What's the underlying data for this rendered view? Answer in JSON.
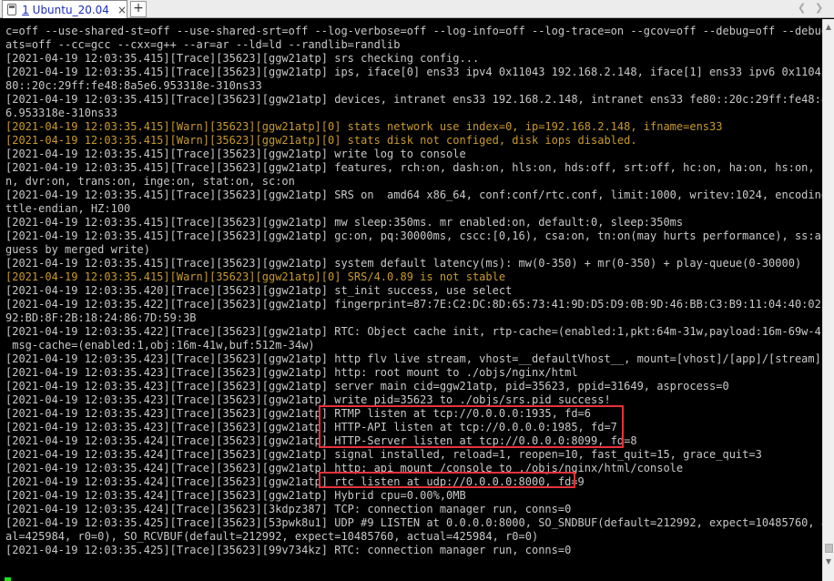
{
  "tabs": [
    {
      "number": "1",
      "label": "Ubuntu_20.04",
      "close": "×"
    }
  ],
  "tabbar": {
    "add": "+",
    "prev": "❮",
    "next": "❯"
  },
  "terminal": {
    "lines": [
      {
        "text": "c=off --use-shared-st=off --use-shared-srt=off --log-verbose=off --log-info=off --log-trace=on --gcov=off --debug=off --debug-st",
        "level": "trace"
      },
      {
        "text": "ats=off --cc=gcc --cxx=g++ --ar=ar --ld=ld --randlib=randlib",
        "level": "trace"
      },
      {
        "text": "[2021-04-19 12:03:35.415][Trace][35623][ggw21atp] srs checking config...",
        "level": "trace"
      },
      {
        "text": "[2021-04-19 12:03:35.415][Trace][35623][ggw21atp] ips, iface[0] ens33 ipv4 0x11043 192.168.2.148, iface[1] ens33 ipv6 0x11043 fe",
        "level": "trace"
      },
      {
        "text": "80::20c:29ff:fe48:8a5e6.953318e-310ns33",
        "level": "trace"
      },
      {
        "text": "[2021-04-19 12:03:35.415][Trace][35623][ggw21atp] devices, intranet ens33 192.168.2.148, intranet ens33 fe80::20c:29ff:fe48:8a5e",
        "level": "trace"
      },
      {
        "text": "6.953318e-310ns33",
        "level": "trace"
      },
      {
        "text": "[2021-04-19 12:03:35.415][Warn][35623][ggw21atp][0] stats network use index=0, ip=192.168.2.148, ifname=ens33",
        "level": "warn"
      },
      {
        "text": "[2021-04-19 12:03:35.415][Warn][35623][ggw21atp][0] stats disk not configed, disk iops disabled.",
        "level": "warn"
      },
      {
        "text": "[2021-04-19 12:03:35.415][Trace][35623][ggw21atp] write log to console",
        "level": "trace"
      },
      {
        "text": "[2021-04-19 12:03:35.415][Trace][35623][ggw21atp] features, rch:on, dash:on, hls:on, hds:off, srt:off, hc:on, ha:on, hs:on, hp:o",
        "level": "trace"
      },
      {
        "text": "n, dvr:on, trans:on, inge:on, stat:on, sc:on",
        "level": "trace"
      },
      {
        "text": "[2021-04-19 12:03:35.415][Trace][35623][ggw21atp] SRS on  amd64 x86_64, conf:conf/rtc.conf, limit:1000, writev:1024, encoding:li",
        "level": "trace"
      },
      {
        "text": "ttle-endian, HZ:100",
        "level": "trace"
      },
      {
        "text": "[2021-04-19 12:03:35.415][Trace][35623][ggw21atp] mw sleep:350ms. mr enabled:on, default:0, sleep:350ms",
        "level": "trace"
      },
      {
        "text": "[2021-04-19 12:03:35.415][Trace][35623][ggw21atp] gc:on, pq:30000ms, cscc:[0,16), csa:on, tn:on(may hurts performance), ss:auto(",
        "level": "trace"
      },
      {
        "text": "guess by merged write)",
        "level": "trace"
      },
      {
        "text": "[2021-04-19 12:03:35.415][Trace][35623][ggw21atp] system default latency(ms): mw(0-350) + mr(0-350) + play-queue(0-30000)",
        "level": "trace"
      },
      {
        "text": "[2021-04-19 12:03:35.415][Warn][35623][ggw21atp][0] SRS/4.0.89 is not stable",
        "level": "warn"
      },
      {
        "text": "[2021-04-19 12:03:35.420][Trace][35623][ggw21atp] st_init success, use select",
        "level": "trace"
      },
      {
        "text": "[2021-04-19 12:03:35.422][Trace][35623][ggw21atp] fingerprint=87:7E:C2:DC:8D:65:73:41:9D:D5:D9:0B:9D:46:BB:C3:B9:11:04:40:02:5E:",
        "level": "trace"
      },
      {
        "text": "92:BD:8F:2B:18:24:86:7D:59:3B",
        "level": "trace"
      },
      {
        "text": "[2021-04-19 12:03:35.422][Trace][35623][ggw21atp] RTC: Object cache init, rtp-cache=(enabled:1,pkt:64m-31w,payload:16m-69w-41w),",
        "level": "trace"
      },
      {
        "text": " msg-cache=(enabled:1,obj:16m-41w,buf:512m-34w)",
        "level": "trace"
      },
      {
        "text": "[2021-04-19 12:03:35.423][Trace][35623][ggw21atp] http flv live stream, vhost=__defaultVhost__, mount=[vhost]/[app]/[stream].flv",
        "level": "trace"
      },
      {
        "text": "[2021-04-19 12:03:35.423][Trace][35623][ggw21atp] http: root mount to ./objs/nginx/html",
        "level": "trace"
      },
      {
        "text": "[2021-04-19 12:03:35.423][Trace][35623][ggw21atp] server main cid=ggw21atp, pid=35623, ppid=31649, asprocess=0",
        "level": "trace"
      },
      {
        "text": "[2021-04-19 12:03:35.423][Trace][35623][ggw21atp] write pid=35623 to ./objs/srs.pid success!",
        "level": "trace"
      },
      {
        "text": "[2021-04-19 12:03:35.423][Trace][35623][ggw21atp] RTMP listen at tcp://0.0.0.0:1935, fd=6",
        "level": "trace"
      },
      {
        "text": "[2021-04-19 12:03:35.423][Trace][35623][ggw21atp] HTTP-API listen at tcp://0.0.0.0:1985, fd=7",
        "level": "trace"
      },
      {
        "text": "[2021-04-19 12:03:35.424][Trace][35623][ggw21atp] HTTP-Server listen at tcp://0.0.0.0:8099, fd=8",
        "level": "trace"
      },
      {
        "text": "[2021-04-19 12:03:35.424][Trace][35623][ggw21atp] signal installed, reload=1, reopen=10, fast_quit=15, grace_quit=3",
        "level": "trace"
      },
      {
        "text": "[2021-04-19 12:03:35.424][Trace][35623][ggw21atp] http: api mount /console to ./objs/nginx/html/console",
        "level": "trace"
      },
      {
        "text": "[2021-04-19 12:03:35.424][Trace][35623][ggw21atp] rtc listen at udp://0.0.0.0:8000, fd=9",
        "level": "trace"
      },
      {
        "text": "[2021-04-19 12:03:35.424][Trace][35623][ggw21atp] Hybrid cpu=0.00%,0MB",
        "level": "trace"
      },
      {
        "text": "[2021-04-19 12:03:35.424][Trace][35623][3kdpz387] TCP: connection manager run, conns=0",
        "level": "trace"
      },
      {
        "text": "[2021-04-19 12:03:35.425][Trace][35623][53pwk8u1] UDP #9 LISTEN at 0.0.0.0:8000, SO_SNDBUF(default=212992, expect=10485760, actu",
        "level": "trace"
      },
      {
        "text": "al=425984, r0=0), SO_RCVBUF(default=212992, expect=10485760, actual=425984, r0=0)",
        "level": "trace"
      },
      {
        "text": "[2021-04-19 12:03:35.425][Trace][35623][99v734kz] RTC: connection manager run, conns=0",
        "level": "trace"
      }
    ]
  },
  "colors": {
    "terminal_bg": "#000000",
    "trace_text": "#c8c8c8",
    "warn_text": "#c89a2a",
    "highlight_box": "#e8313a",
    "cursor": "#1fe01f"
  }
}
